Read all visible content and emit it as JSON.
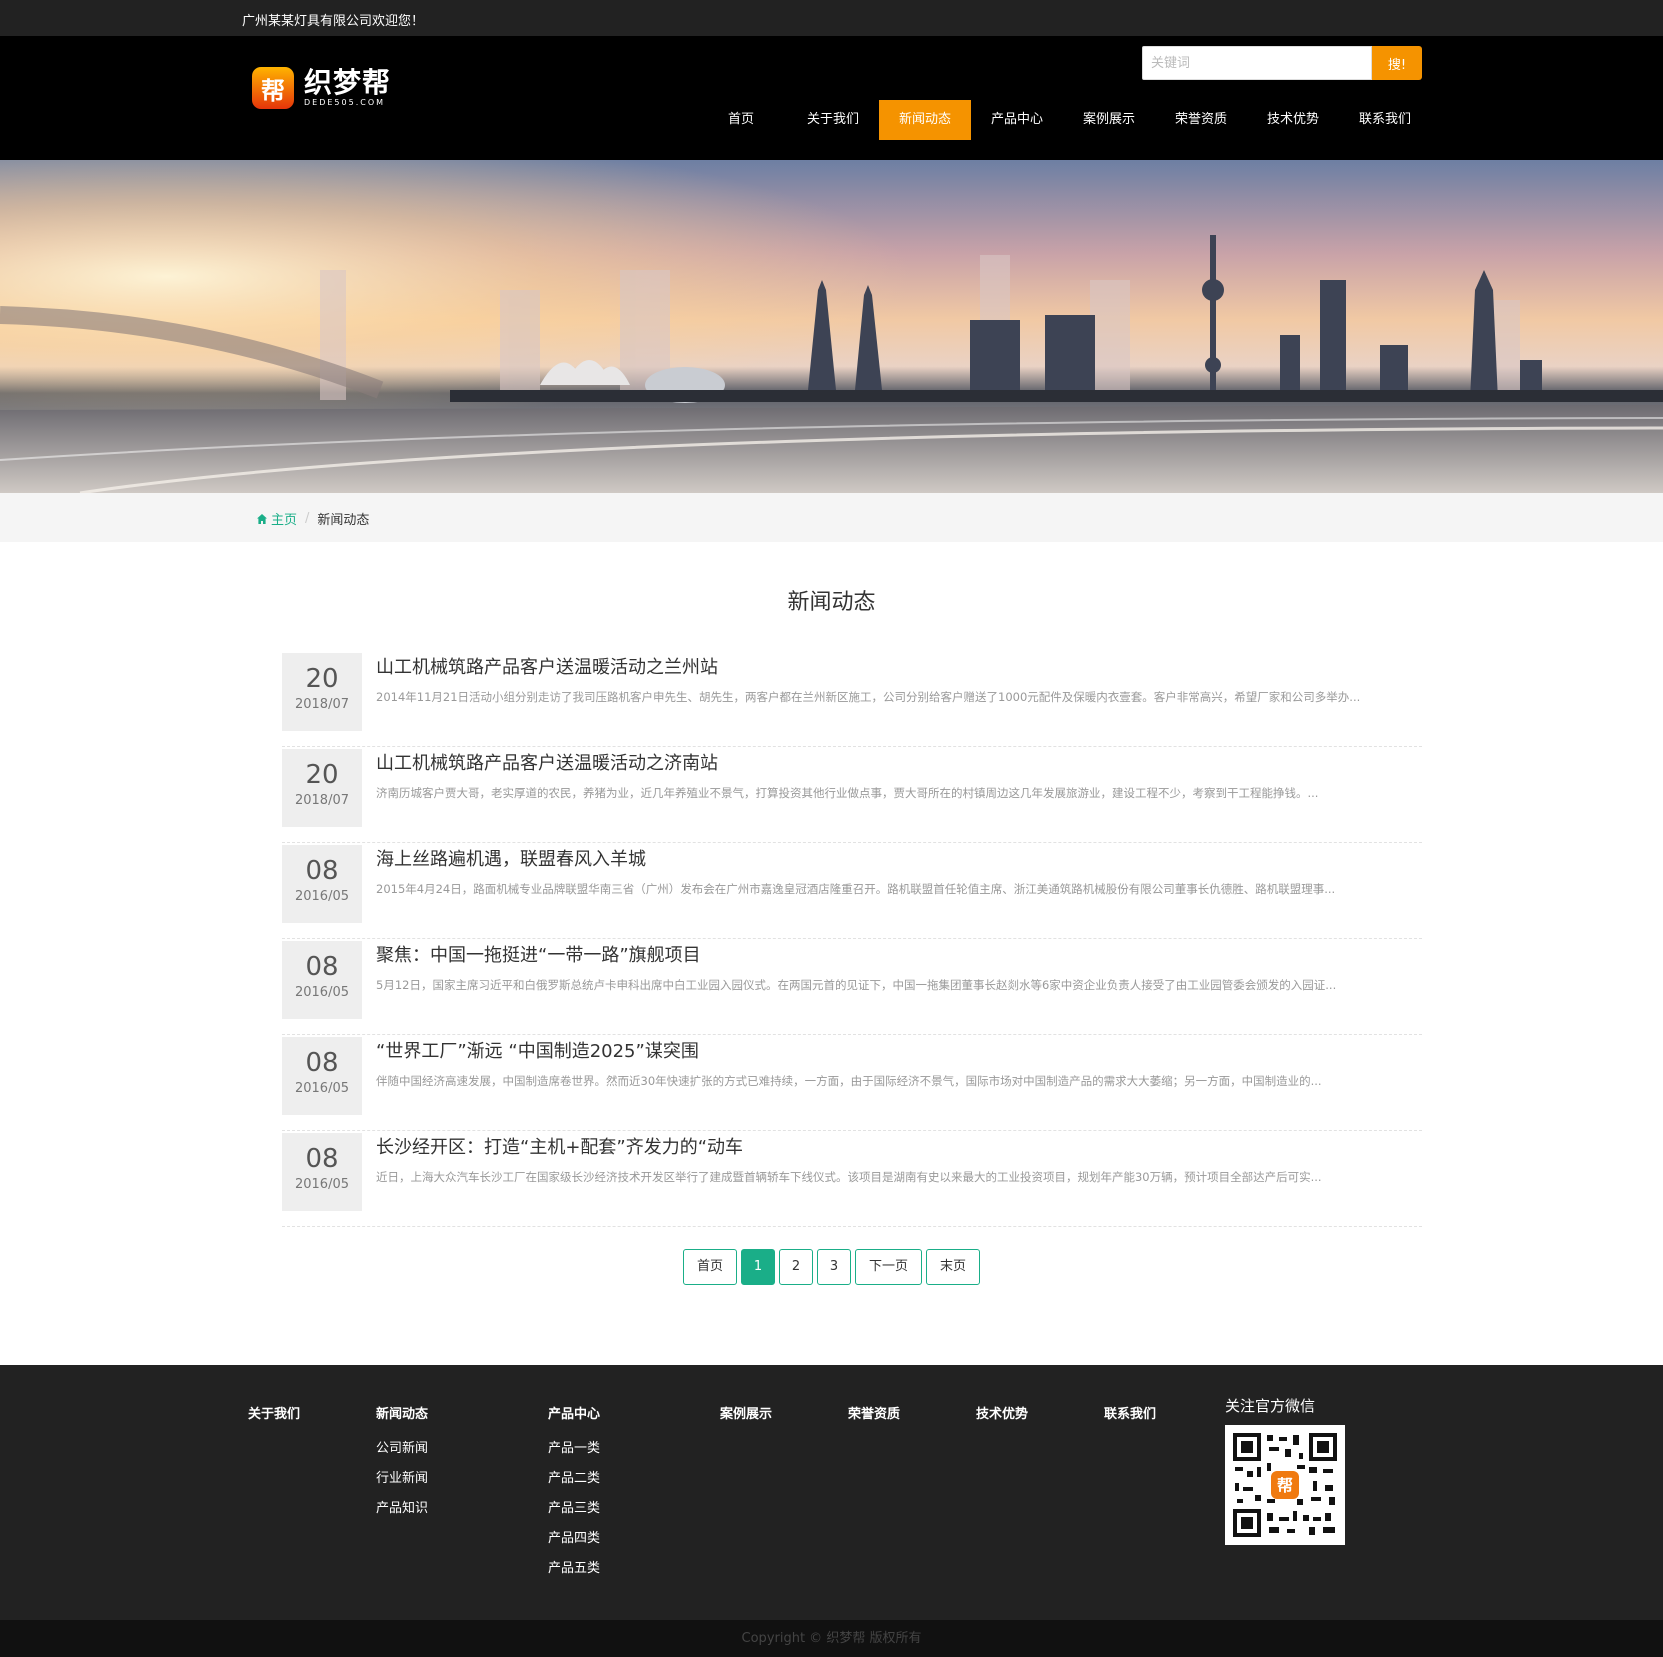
{
  "topbar": {
    "welcome": "广州某某灯具有限公司欢迎您！"
  },
  "header": {
    "logo_badge": "帮",
    "logo_main": "织梦帮",
    "logo_sub": "DEDE505.COM",
    "search_placeholder": "关键词",
    "search_button": "搜!"
  },
  "nav": {
    "items": [
      {
        "label": "首页"
      },
      {
        "label": "关于我们"
      },
      {
        "label": "新闻动态",
        "active": true
      },
      {
        "label": "产品中心"
      },
      {
        "label": "案例展示"
      },
      {
        "label": "荣誉资质"
      },
      {
        "label": "技术优势"
      },
      {
        "label": "联系我们"
      }
    ]
  },
  "breadcrumb": {
    "home": "主页",
    "current": "新闻动态"
  },
  "page": {
    "title": "新闻动态"
  },
  "news": [
    {
      "day": "20",
      "ym": "2018/07",
      "title": "山工机械筑路产品客户送温暖活动之兰州站",
      "summary": "2014年11月21日活动小组分别走访了我司压路机客户申先生、胡先生，两客户都在兰州新区施工，公司分别给客户赠送了1000元配件及保暖内衣壹套。客户非常高兴，希望厂家和公司多举办..."
    },
    {
      "day": "20",
      "ym": "2018/07",
      "title": "山工机械筑路产品客户送温暖活动之济南站",
      "summary": "济南历城客户贾大哥，老实厚道的农民，养猪为业，近几年养殖业不景气，打算投资其他行业做点事，贾大哥所在的村镇周边这几年发展旅游业，建设工程不少，考察到干工程能挣钱。..."
    },
    {
      "day": "08",
      "ym": "2016/05",
      "title": "海上丝路遍机遇，联盟春风入羊城",
      "summary": "2015年4月24日，路面机械专业品牌联盟华南三省（广州）发布会在广州市嘉逸皇冠酒店隆重召开。路机联盟首任轮值主席、浙江美通筑路机械股份有限公司董事长仇德胜、路机联盟理事..."
    },
    {
      "day": "08",
      "ym": "2016/05",
      "title": "聚焦：中国一拖挺进“一带一路”旗舰项目",
      "summary": "5月12日，国家主席习近平和白俄罗斯总统卢卡申科出席中白工业园入园仪式。在两国元首的见证下，中国一拖集团董事长赵剡水等6家中资企业负责人接受了由工业园管委会颁发的入园证..."
    },
    {
      "day": "08",
      "ym": "2016/05",
      "title": "“世界工厂”渐远 “中国制造2025”谋突围",
      "summary": "伴随中国经济高速发展，中国制造席卷世界。然而近30年快速扩张的方式已难持续，一方面，由于国际经济不景气，国际市场对中国制造产品的需求大大萎缩；另一方面，中国制造业的..."
    },
    {
      "day": "08",
      "ym": "2016/05",
      "title": "长沙经开区：打造“主机+配套”齐发力的“动车",
      "summary": "近日，上海大众汽车长沙工厂在国家级长沙经济技术开发区举行了建成暨首辆轿车下线仪式。该项目是湖南有史以来最大的工业投资项目，规划年产能30万辆，预计项目全部达产后可实..."
    }
  ],
  "pager": {
    "first": "首页",
    "pages": [
      "1",
      "2",
      "3"
    ],
    "current": "1",
    "next": "下一页",
    "last": "末页"
  },
  "footer": {
    "cols": [
      {
        "title": "关于我们",
        "links": []
      },
      {
        "title": "新闻动态",
        "links": [
          "公司新闻",
          "行业新闻",
          "产品知识"
        ]
      },
      {
        "title": "产品中心",
        "links": [
          "产品一类",
          "产品二类",
          "产品三类",
          "产品四类",
          "产品五类"
        ]
      },
      {
        "title": "案例展示",
        "links": []
      },
      {
        "title": "荣誉资质",
        "links": []
      },
      {
        "title": "技术优势",
        "links": []
      },
      {
        "title": "联系我们",
        "links": []
      }
    ],
    "wechat_title": "关注官方微信",
    "qr_badge": "帮",
    "copyright": "Copyright © 织梦帮 版权所有"
  },
  "colors": {
    "accent": "#f59300",
    "green": "#1aae88",
    "topbar": "#222222",
    "header": "#000000"
  }
}
